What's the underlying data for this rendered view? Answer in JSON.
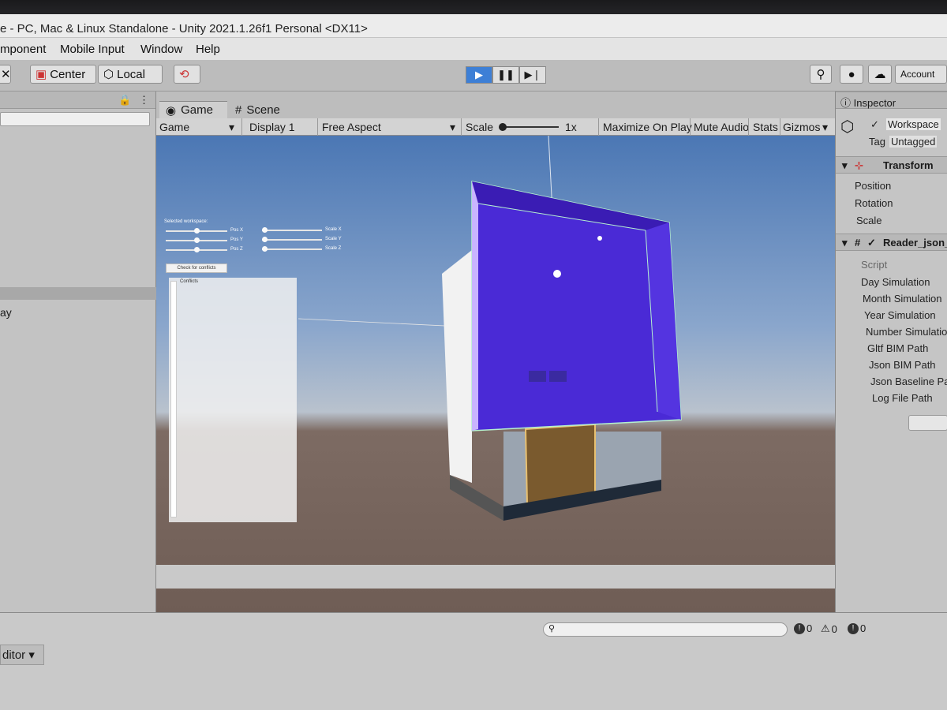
{
  "window": {
    "title": "e - PC, Mac & Linux Standalone - Unity 2021.1.26f1 Personal <DX11>"
  },
  "menu": [
    "mponent",
    "Mobile Input",
    "Window",
    "Help"
  ],
  "toolbar": {
    "center_label": "Center",
    "local_label": "Local",
    "account_label": "Account"
  },
  "hierarchy": {
    "partial_item": "ay"
  },
  "tabs": {
    "game": "Game",
    "scene": "Scene"
  },
  "game_toolbar": {
    "game_select": "Game",
    "display_select": "Display 1",
    "aspect_select": "Free Aspect",
    "scale_label": "Scale",
    "scale_value": "1x",
    "maximize": "Maximize On Play",
    "mute": "Mute Audio",
    "stats": "Stats",
    "gizmos": "Gizmos"
  },
  "game_ui": {
    "heading": "Selected workspace:",
    "pos_x": "Pos X",
    "pos_y": "Pos Y",
    "pos_z": "Pos Z",
    "scale_x": "Scale X",
    "scale_y": "Scale Y",
    "scale_z": "Scale Z",
    "check_button": "Check for conflicts",
    "conflicts_label": "Conflicts"
  },
  "inspector": {
    "tab": "Inspector",
    "object_name": "Workspace",
    "tag_label": "Tag",
    "tag_value": "Untagged",
    "transform": "Transform",
    "position": "Position",
    "rotation": "Rotation",
    "scale": "Scale",
    "script_component": "Reader_json_",
    "script_label": "Script",
    "fields": [
      "Day Simulation",
      "Month Simulation",
      "Year Simulation",
      "Number Simulation",
      "Gltf BIM Path",
      "Json BIM Path",
      "Json Baseline Pat",
      "Log File Path"
    ]
  },
  "console": {
    "error_count": "0",
    "warning_count": "0",
    "info_count": "0",
    "editor_label": "ditor"
  },
  "colors": {
    "play_active": "#3d7fd6",
    "selection": "#2c5cb4",
    "workspace_box": "#4a2ad6"
  }
}
